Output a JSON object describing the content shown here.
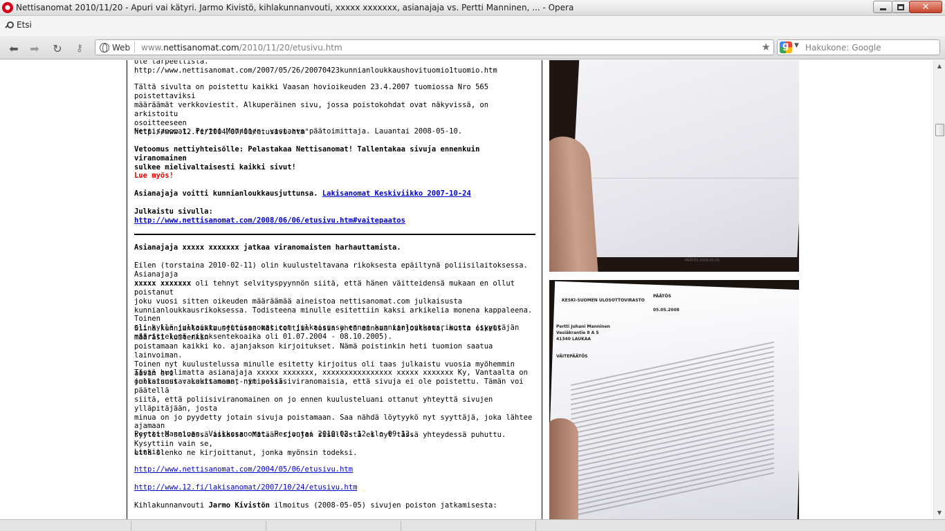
{
  "window": {
    "title": "Nettisanomat 2010/11/20 - Apuri vai kätyri. Jarmo Kivistö, kihlakunnanvouti, xxxxx xxxxxxx, asianajaja vs. Pertti Manninen, ... - Opera"
  },
  "menu": {
    "search_label": "Etsi"
  },
  "toolbar": {
    "address_badge": "Web",
    "url_domain_prefix": "www.",
    "url_domain": "nettisanomat.com",
    "url_path": "/2010/11/20/etusivu.htm",
    "search_placeholder": "Hakukone: Google"
  },
  "article": {
    "p0": "ole tarpeellista.\nhttp://www.nettisanomat.com/2007/05/26/20070423kunnianloukkaushovituomio1tuomio.htm",
    "p1": "Tältä sivulta on poistettu kaikki Vaasan hovioikeuden 23.4.2007 tuomiossa Nro 565 poistettaviksi\nmääräämät verkkoviestit. Alkuperäinen sivu, jossa poistokohdat ovat näkyvissä, on arkistoitu\nosoitteeseen\nhttp://www.12.fi/2004/07/01/etusivu.htm\"",
    "p2": "Nettisanomat. Pertti Manninen, vastaava päätoimittaja. Lauantai 2008-05-10.",
    "p3": "Vetoomus nettiyhteisölle: Pelastakaa Nettisanomat! Tallentakaa sivuja ennenkuin viranomainen\nsulkee mielivaltaisesti kaikki sivut!",
    "see_also": "Lue myös!",
    "p4_text": "Asianajaja voitti kunnianloukkausjuttunsa. ",
    "p4_link": "Lakisanomat Keskiviikko 2007-10-24",
    "p5_label": "Julkaistu sivulla:",
    "p5_link": "http://www.nettisanomat.com/2008/06/06/etusivu.htm#vaitepaatos",
    "heading": "Asianajaja xxxxx xxxxxxx jatkaa viranomaisten harhauttamista.",
    "p6a": "Eilen (torstaina 2010-02-11) olin kuulusteltavana rikoksesta epäiltynä poliisilaitoksessa. Asianajaja\n",
    "p6b": "xxxxx xxxxxxx",
    "p6c": " oli tehnyt selvityspyynnön siitä, että hänen väitteidensä mukaan en ollut poistanut\njoku vuosi sitten oikeuden määräämää aineistoa nettisanomat.com julkaisusta\nkunnianloukkausrikoksessa. Todisteena minulle esitettiin kaksi arkikelia monena kappaleena. Toinen\noli kyllä julkaistu nettisanomat.com julkaisussa ennen kunnianloukkausrikosta (syyttäjän\nmäärittelemä rikoksentekoaika oli 01.07.2004 - 08.10.2005).",
    "p7": "Siinä kunnianloukkausjutussa käsiteltiin tosin yhtä ainoaa kirjoitusta, mutta oikeus määräsi kuitenkin\npoistamaan kaikki ko. ajanjakson kirjoitukset. Nämä poistinkin heti tuomion saatua lainvoiman.\nToinen nyt kuulustelussa minulle esitetty kirjoitus oli taas julkaistu vuosia myöhemmin aivan eri\njulkaisussa: Lakisanomat-nimisessä.",
    "p8": "Tästä huolimatta asianajaja xxxxx xxxxxxx, xxxxxxxxxxxxxxxx xxxxx xxxxxxx Ky, Vantaalta on\nonnistunut vakuuttamaan, nyt poliisiviranomaisia, että sivuja ei ole poistettu. Tämän voi päätellä\nsiitä, että poliisiviranomainen on jo ennen kuulusteluani ottanut yhteyttä sivujen ylläpitäjään, josta\nminua on jo pyydetty jotain sivuja poistamaan. Saa nähdä löytyykö nyt syyttäjä, joka lähtee ajamaan\nsyytettä selvässä asiassa. Mitään sivujen sisällöstä ei nyt tässä yhteydessä puhuttu. Kysyttiin vain se,\nettä olenko ne kirjoittanut, jonka myönsin todeksi.",
    "p9": "Pertti Manninen. Viikkosanomat. Perjantai 2010-02- 12 klo 09:13.",
    "links_label": "Linkit:",
    "link1": "http://www.nettisanomat.com/2004/05/06/etusivu.htm",
    "link2": "http://www.12.fi/lakisanomat/2007/10/24/etusivu.htm",
    "p10a": "Kihlakunnanvouti ",
    "p10b": "Jarmo Kivistön",
    "p10c": " ilmoitus (2008-05-05) sivujen poiston jatkamisesta:"
  },
  "photos": {
    "photo1_caption": "PÄÄTÖS 2008-05-05",
    "photo2_org": "KESKI-SUOMEN ULOSOTTOVIRASTO",
    "photo2_doc": "PÄÄTÖS",
    "photo2_name": "Pertti Juhani Manninen",
    "photo2_addr1": "Vesiäkrantie 8 A 5",
    "photo2_addr2": "41340 LAUKAA",
    "photo2_section": "VÄITEPÄÄTÖS",
    "photo2_date": "05.05.2008"
  },
  "colors": {
    "link": "#0000cc",
    "alert_red": "#e60000",
    "close_button": "#c8442b"
  }
}
